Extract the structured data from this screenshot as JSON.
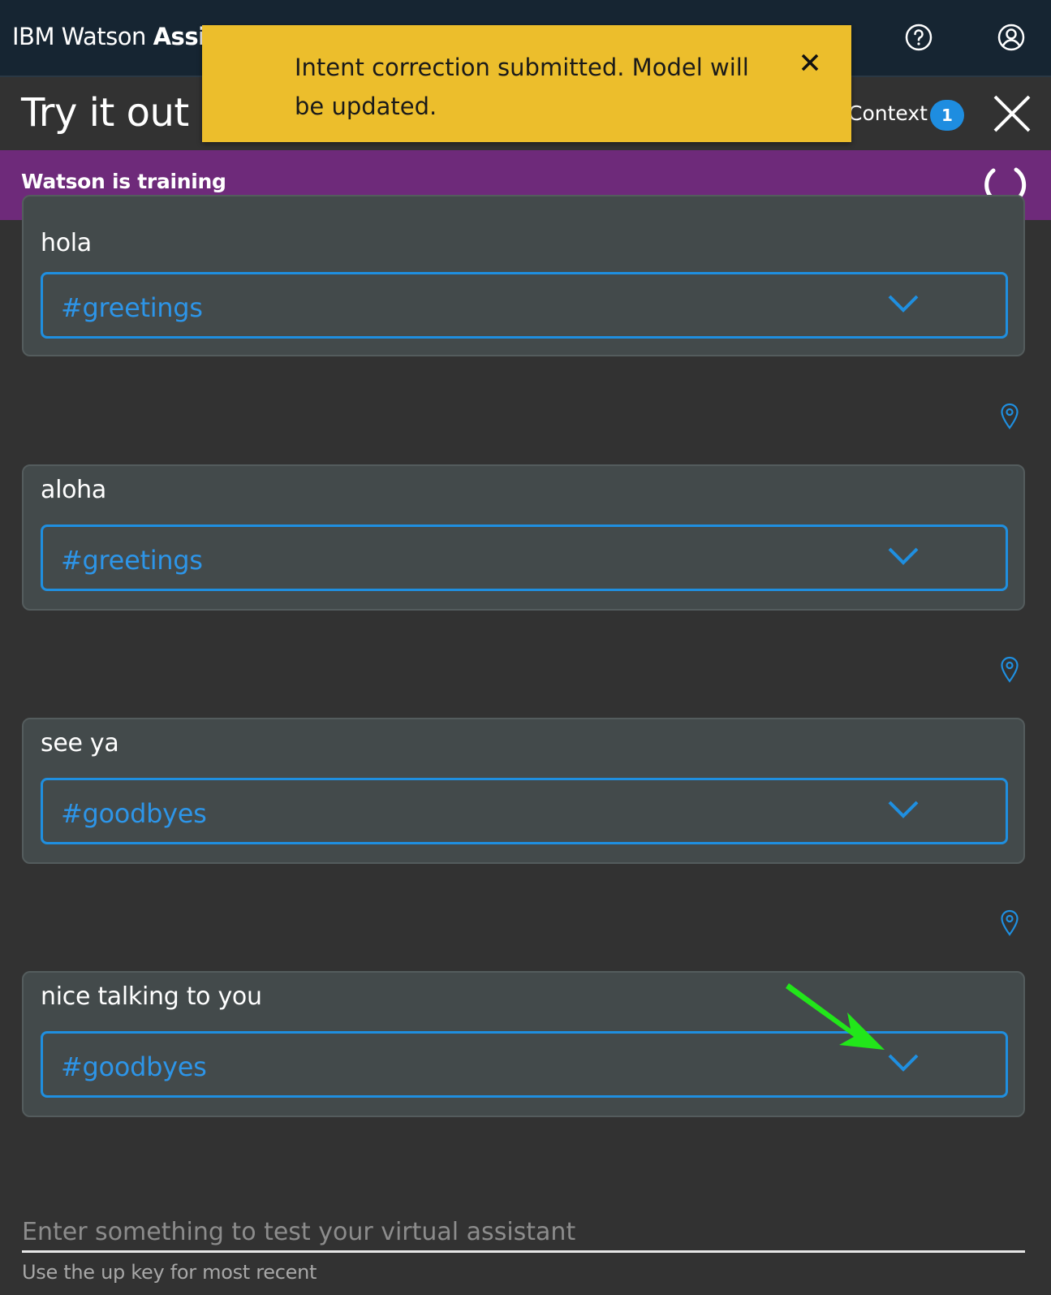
{
  "topbar": {
    "brand_regular": "IBM Watson ",
    "brand_bold": "Assistant",
    "icons": [
      "help-icon",
      "user-icon"
    ]
  },
  "header": {
    "title": "Try it out",
    "context_label": "Context",
    "context_count": "1"
  },
  "training_banner": {
    "text": "Watson is training"
  },
  "notification": {
    "message": "Intent correction submitted. Model will be updated.",
    "color": "#ecbe2c"
  },
  "messages": [
    {
      "text": "hola",
      "intent": "#greetings"
    },
    {
      "text": "aloha",
      "intent": "#greetings"
    },
    {
      "text": "see ya",
      "intent": "#goodbyes"
    },
    {
      "text": "nice talking to you",
      "intent": "#goodbyes"
    }
  ],
  "input": {
    "placeholder": "Enter something to test your virtual assistant",
    "hint": "Use the up key for most recent"
  },
  "colors": {
    "accent": "#1f8fe0",
    "training_banner": "#6e2a7a",
    "topbar": "#162532",
    "background": "#323232",
    "annotation_arrow": "#22e61a"
  }
}
